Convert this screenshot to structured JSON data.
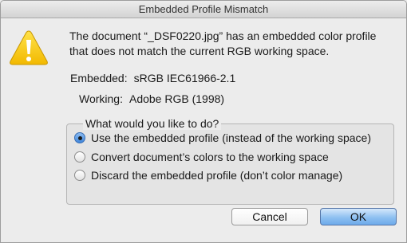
{
  "window": {
    "title": "Embedded Profile Mismatch"
  },
  "message": "The document “_DSF0220.jpg” has an embedded color profile that does not match the current RGB working space.",
  "embedded": {
    "label": "Embedded:",
    "value": "sRGB IEC61966-2.1"
  },
  "working": {
    "label": "Working:",
    "value": "Adobe RGB (1998)"
  },
  "options": {
    "legend": "What would you like to do?",
    "items": [
      {
        "label": "Use the embedded profile (instead of the working space)",
        "selected": true
      },
      {
        "label": "Convert document’s colors to the working space",
        "selected": false
      },
      {
        "label": "Discard the embedded profile (don’t color manage)",
        "selected": false
      }
    ]
  },
  "buttons": {
    "cancel": "Cancel",
    "ok": "OK"
  },
  "icons": {
    "warning": "warning-triangle-icon"
  },
  "colors": {
    "warning_yellow": "#f5c400",
    "default_button": "#8ec0f1"
  }
}
